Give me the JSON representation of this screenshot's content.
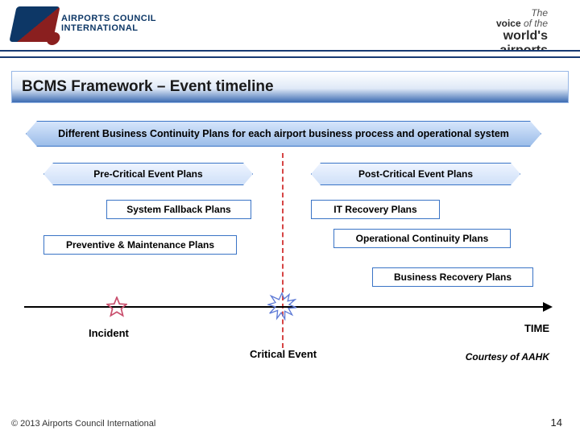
{
  "header": {
    "org_line1": "AIRPORTS COUNCIL",
    "org_line2": "INTERNATIONAL",
    "tag_the": "The",
    "tag_voice": "voice",
    "tag_of": "of the",
    "tag_worlds": "world's",
    "tag_airports": "airports"
  },
  "title": "BCMS Framework – Event timeline",
  "banner": "Different Business Continuity Plans for each airport business process and operational system",
  "boxes": {
    "pre": "Pre-Critical Event Plans",
    "post": "Post-Critical Event Plans",
    "sys_fallback": "System Fallback Plans",
    "it_recovery": "IT Recovery Plans",
    "prev_maint": "Preventive & Maintenance Plans",
    "op_cont": "Operational Continuity Plans",
    "biz_recovery": "Business Recovery Plans"
  },
  "labels": {
    "incident": "Incident",
    "critical": "Critical Event",
    "time": "TIME",
    "courtesy": "Courtesy of AAHK"
  },
  "footer": "© 2013 Airports Council International",
  "page": "14"
}
